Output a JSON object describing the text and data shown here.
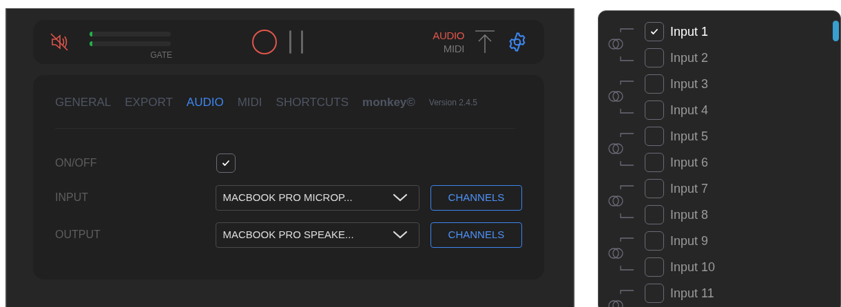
{
  "transport": {
    "muted": true,
    "meters": [
      {
        "level": 0.03
      },
      {
        "level": 0.03
      }
    ],
    "meter_label": "GATE",
    "mode_options": [
      {
        "label": "AUDIO",
        "selected": true
      },
      {
        "label": "MIDI",
        "selected": false
      }
    ]
  },
  "tabs": [
    {
      "label": "GENERAL",
      "selected": false
    },
    {
      "label": "EXPORT",
      "selected": false
    },
    {
      "label": "AUDIO",
      "selected": true
    },
    {
      "label": "MIDI",
      "selected": false
    },
    {
      "label": "SHORTCUTS",
      "selected": false
    }
  ],
  "brand": "monkey©",
  "version": "Version 2.4.5",
  "settings": [
    {
      "kind": "checkbox",
      "label": "ON/OFF",
      "checked": true
    },
    {
      "kind": "device",
      "label": "INPUT",
      "value": "MACBOOK PRO MICROP...",
      "button": "CHANNELS"
    },
    {
      "kind": "device",
      "label": "OUTPUT",
      "value": "MACBOOK PRO SPEAKE...",
      "button": "CHANNELS"
    }
  ],
  "channels": [
    {
      "label": "Input 1",
      "checked": true
    },
    {
      "label": "Input 2",
      "checked": false
    },
    {
      "label": "Input 3",
      "checked": false
    },
    {
      "label": "Input 4",
      "checked": false
    },
    {
      "label": "Input 5",
      "checked": false
    },
    {
      "label": "Input 6",
      "checked": false
    },
    {
      "label": "Input 7",
      "checked": false
    },
    {
      "label": "Input 8",
      "checked": false
    },
    {
      "label": "Input 9",
      "checked": false
    },
    {
      "label": "Input 10",
      "checked": false
    },
    {
      "label": "Input 11",
      "checked": false
    }
  ]
}
